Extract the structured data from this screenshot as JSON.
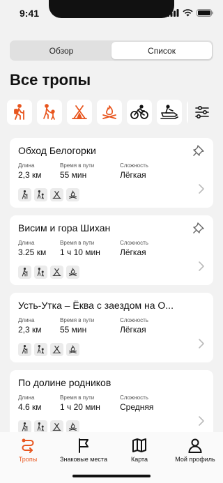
{
  "status": {
    "time": "9:41"
  },
  "segments": [
    {
      "label": "Обзор",
      "active": false
    },
    {
      "label": "Список",
      "active": true
    }
  ],
  "page_title": "Все тропы",
  "filters": [
    "hiking-icon",
    "family-hiking-icon",
    "camping-icon",
    "campfire-icon",
    "cycling-icon",
    "snowmobile-icon"
  ],
  "labels": {
    "length": "Длина",
    "time": "Время в пути",
    "difficulty": "Сложность"
  },
  "trails": [
    {
      "title": "Обход Белогорки",
      "length": "2,3 км",
      "time": "55 мин",
      "difficulty": "Лёгкая",
      "pinned": true
    },
    {
      "title": "Висим и гора Шихан",
      "length": "3.25 км",
      "time": "1 ч 10 мин",
      "difficulty": "Лёгкая",
      "pinned": true
    },
    {
      "title": "Усть-Утка – Ёква с заездом на О...",
      "length": "2,3 км",
      "time": "55 мин",
      "difficulty": "Лёгкая",
      "pinned": false
    },
    {
      "title": "По долине родников",
      "length": "4.6 км",
      "time": "1 ч 20 мин",
      "difficulty": "Средняя",
      "pinned": false
    }
  ],
  "tabs": [
    {
      "label": "Тропы",
      "icon": "route-icon",
      "active": true
    },
    {
      "label": "Знаковые места",
      "icon": "flag-icon",
      "active": false
    },
    {
      "label": "Карта",
      "icon": "map-icon",
      "active": false
    },
    {
      "label": "Мой профиль",
      "icon": "profile-icon",
      "active": false
    }
  ],
  "colors": {
    "accent": "#e8561f",
    "background": "#f2f2f2",
    "card": "#ffffff"
  }
}
